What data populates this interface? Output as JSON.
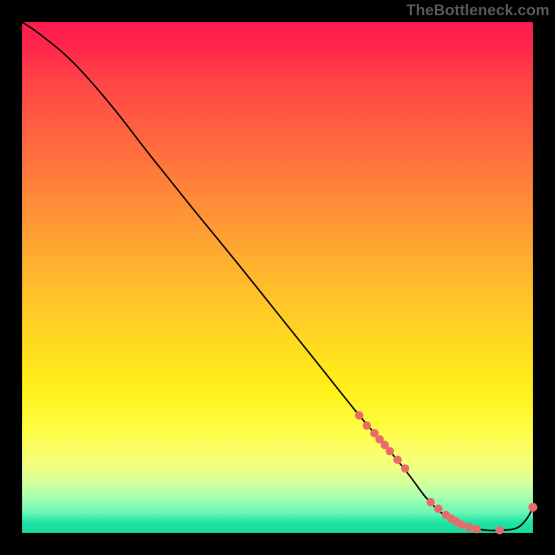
{
  "watermark": "TheBottleneck.com",
  "colors": {
    "frame_bg": "#000000",
    "gradient_top": "#ff1a4f",
    "gradient_mid1": "#ff8e37",
    "gradient_mid2": "#fff019",
    "gradient_bottom": "#18db9f",
    "curve": "#000000",
    "marker": "#e86a6a",
    "watermark": "#5a5a5a"
  },
  "chart_data": {
    "type": "line",
    "title": "",
    "xlabel": "",
    "ylabel": "",
    "xlim": [
      0,
      100
    ],
    "ylim": [
      0,
      100
    ],
    "grid": false,
    "legend": false,
    "series": [
      {
        "name": "bottleneck-curve",
        "x": [
          0,
          3,
          8,
          12,
          18,
          25,
          33,
          42,
          50,
          58,
          66,
          72,
          76,
          79,
          82,
          85,
          88,
          91,
          94,
          97,
          99,
          100
        ],
        "y": [
          100,
          98,
          94,
          90,
          83,
          74,
          64,
          53,
          43,
          33,
          23,
          16,
          11,
          7,
          4,
          2,
          1,
          0.5,
          0.5,
          1,
          3,
          5
        ]
      }
    ],
    "markers": [
      {
        "name": "cluster-upper",
        "points": [
          {
            "x": 66,
            "y": 23
          },
          {
            "x": 67.5,
            "y": 21
          },
          {
            "x": 69,
            "y": 19.5
          },
          {
            "x": 70,
            "y": 18.3
          },
          {
            "x": 71,
            "y": 17.2
          },
          {
            "x": 72,
            "y": 16
          },
          {
            "x": 73.5,
            "y": 14.3
          },
          {
            "x": 75,
            "y": 12.6
          }
        ]
      },
      {
        "name": "cluster-lower",
        "points": [
          {
            "x": 80,
            "y": 6
          },
          {
            "x": 81.5,
            "y": 4.7
          },
          {
            "x": 83,
            "y": 3.5
          },
          {
            "x": 84,
            "y": 2.8
          },
          {
            "x": 85,
            "y": 2.2
          },
          {
            "x": 86,
            "y": 1.6
          },
          {
            "x": 87.5,
            "y": 1.1
          },
          {
            "x": 89,
            "y": 0.7
          },
          {
            "x": 93.5,
            "y": 0.5
          }
        ]
      },
      {
        "name": "end-point",
        "points": [
          {
            "x": 100,
            "y": 5
          }
        ]
      }
    ]
  }
}
